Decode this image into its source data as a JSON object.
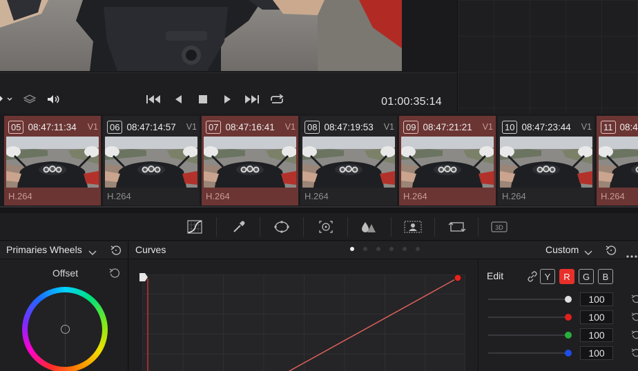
{
  "transport": {
    "timecode": "01:00:35:14"
  },
  "clips": [
    {
      "num": "",
      "timecode": "",
      "track": "",
      "codec": "",
      "selected": true
    },
    {
      "num": "05",
      "timecode": "08:47:11:34",
      "track": "V1",
      "codec": "H.264",
      "selected": true
    },
    {
      "num": "06",
      "timecode": "08:47:14:57",
      "track": "V1",
      "codec": "H.264",
      "selected": false
    },
    {
      "num": "07",
      "timecode": "08:47:16:41",
      "track": "V1",
      "codec": "H.264",
      "selected": true
    },
    {
      "num": "08",
      "timecode": "08:47:19:53",
      "track": "V1",
      "codec": "H.264",
      "selected": false
    },
    {
      "num": "09",
      "timecode": "08:47:21:21",
      "track": "V1",
      "codec": "H.264",
      "selected": true
    },
    {
      "num": "10",
      "timecode": "08:47:23:44",
      "track": "V1",
      "codec": "H.264",
      "selected": false
    },
    {
      "num": "11",
      "timecode": "08:4",
      "track": "",
      "codec": "H.264",
      "selected": true
    }
  ],
  "wheels_panel": {
    "title": "Primaries Wheels",
    "wheel_label": "Offset"
  },
  "curves_panel": {
    "title": "Curves",
    "mode": "Custom",
    "page_dots": 6,
    "active_dot": 0
  },
  "edit_panel": {
    "label": "Edit",
    "channels": [
      "Y",
      "R",
      "G",
      "B"
    ],
    "active_channel": "R",
    "sliders": [
      {
        "color": "#e0e0e0",
        "value": "100"
      },
      {
        "color": "#e0201c",
        "value": "100"
      },
      {
        "color": "#28b03a",
        "value": "100"
      },
      {
        "color": "#1e4ee8",
        "value": "100"
      }
    ]
  },
  "colors": {
    "selected_clip": "#6b3533",
    "curve_red": "#e8645a",
    "channel_active": "#e8302a"
  }
}
